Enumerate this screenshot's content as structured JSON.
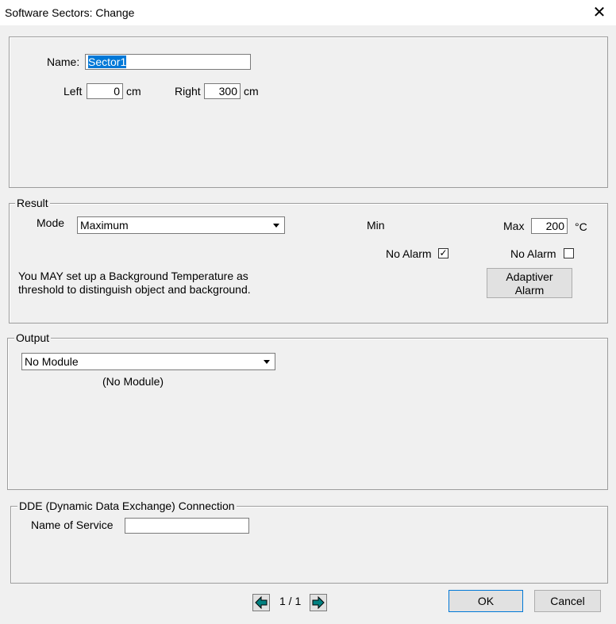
{
  "window": {
    "title": "Software Sectors: Change"
  },
  "general": {
    "name_label": "Name:",
    "name_value": "Sector1",
    "left_label": "Left",
    "left_value": "0",
    "left_unit": "cm",
    "right_label": "Right",
    "right_value": "300",
    "right_unit": "cm"
  },
  "result": {
    "legend": "Result",
    "mode_label": "Mode",
    "mode_value": "Maximum",
    "min_label": "Min",
    "max_label": "Max",
    "max_value": "200",
    "max_unit": "°C",
    "min_no_alarm_label": "No Alarm",
    "min_no_alarm_checked": true,
    "max_no_alarm_label": "No Alarm",
    "max_no_alarm_checked": false,
    "note_line1": "You MAY set up a Background Temperature as",
    "note_line2": "threshold to distinguish object and background.",
    "adaptive_btn_line1": "Adaptiver",
    "adaptive_btn_line2": "Alarm"
  },
  "output": {
    "legend": "Output",
    "module_value": "No Module",
    "module_caption": "(No Module)"
  },
  "dde": {
    "legend": "DDE (Dynamic Data Exchange) Connection",
    "service_label": "Name of Service",
    "service_value": ""
  },
  "footer": {
    "page_indicator": "1 / 1",
    "ok_label": "OK",
    "cancel_label": "Cancel"
  },
  "icons": {
    "close": "close-icon",
    "prev": "arrow-left-icon",
    "next": "arrow-right-icon",
    "dropdown": "chevron-down-icon",
    "nav_color": "#008080"
  }
}
